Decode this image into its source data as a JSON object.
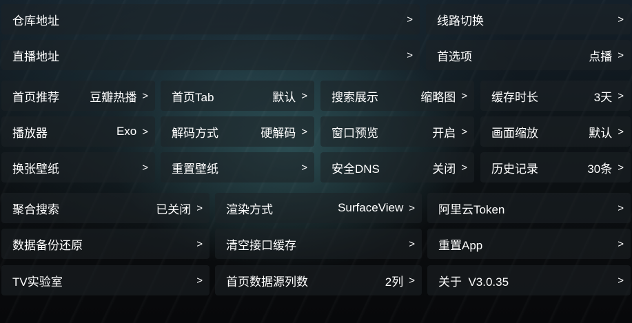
{
  "rows": [
    [
      {
        "label": "仓库地址",
        "value": "",
        "arrow": ">"
      },
      {
        "label": "线路切换",
        "value": "",
        "arrow": ">"
      }
    ],
    [
      {
        "label": "直播地址",
        "value": "",
        "arrow": ">"
      },
      {
        "label": "首选项",
        "value": "点播",
        "arrow": ">"
      }
    ],
    [
      {
        "label": "首页推荐",
        "value": "豆瓣热播",
        "arrow": ">"
      },
      {
        "label": "首页Tab",
        "value": "默认",
        "arrow": ">"
      },
      {
        "label": "搜索展示",
        "value": "缩略图",
        "arrow": ">"
      },
      {
        "label": "缓存时长",
        "value": "3天",
        "arrow": ">"
      }
    ],
    [
      {
        "label": "播放器",
        "value": "Exo",
        "arrow": ">"
      },
      {
        "label": "解码方式",
        "value": "硬解码",
        "arrow": ">"
      },
      {
        "label": "窗口预览",
        "value": "开启",
        "arrow": ">"
      },
      {
        "label": "画面缩放",
        "value": "默认",
        "arrow": ">"
      }
    ],
    [
      {
        "label": "换张壁纸",
        "value": "",
        "arrow": ">"
      },
      {
        "label": "重置壁纸",
        "value": "",
        "arrow": ">"
      },
      {
        "label": "安全DNS",
        "value": "关闭",
        "arrow": ">"
      },
      {
        "label": "历史记录",
        "value": "30条",
        "arrow": ">"
      }
    ],
    [
      {
        "label": "聚合搜索",
        "value": "已关闭",
        "arrow": ">"
      },
      {
        "label": "渲染方式",
        "value": "SurfaceView",
        "arrow": ">"
      },
      {
        "label": "阿里云Token",
        "value": "",
        "arrow": ">"
      }
    ],
    [
      {
        "label": "数据备份还原",
        "value": "",
        "arrow": ">"
      },
      {
        "label": "清空接口缓存",
        "value": "",
        "arrow": ">"
      },
      {
        "label": "重置App",
        "value": "",
        "arrow": ">"
      }
    ],
    [
      {
        "label": "TV实验室",
        "value": "",
        "arrow": ">"
      },
      {
        "label": "首页数据源列数",
        "value": "2列",
        "arrow": ">"
      },
      {
        "label": "关于  V3.0.35",
        "value": "",
        "arrow": ">"
      }
    ]
  ]
}
